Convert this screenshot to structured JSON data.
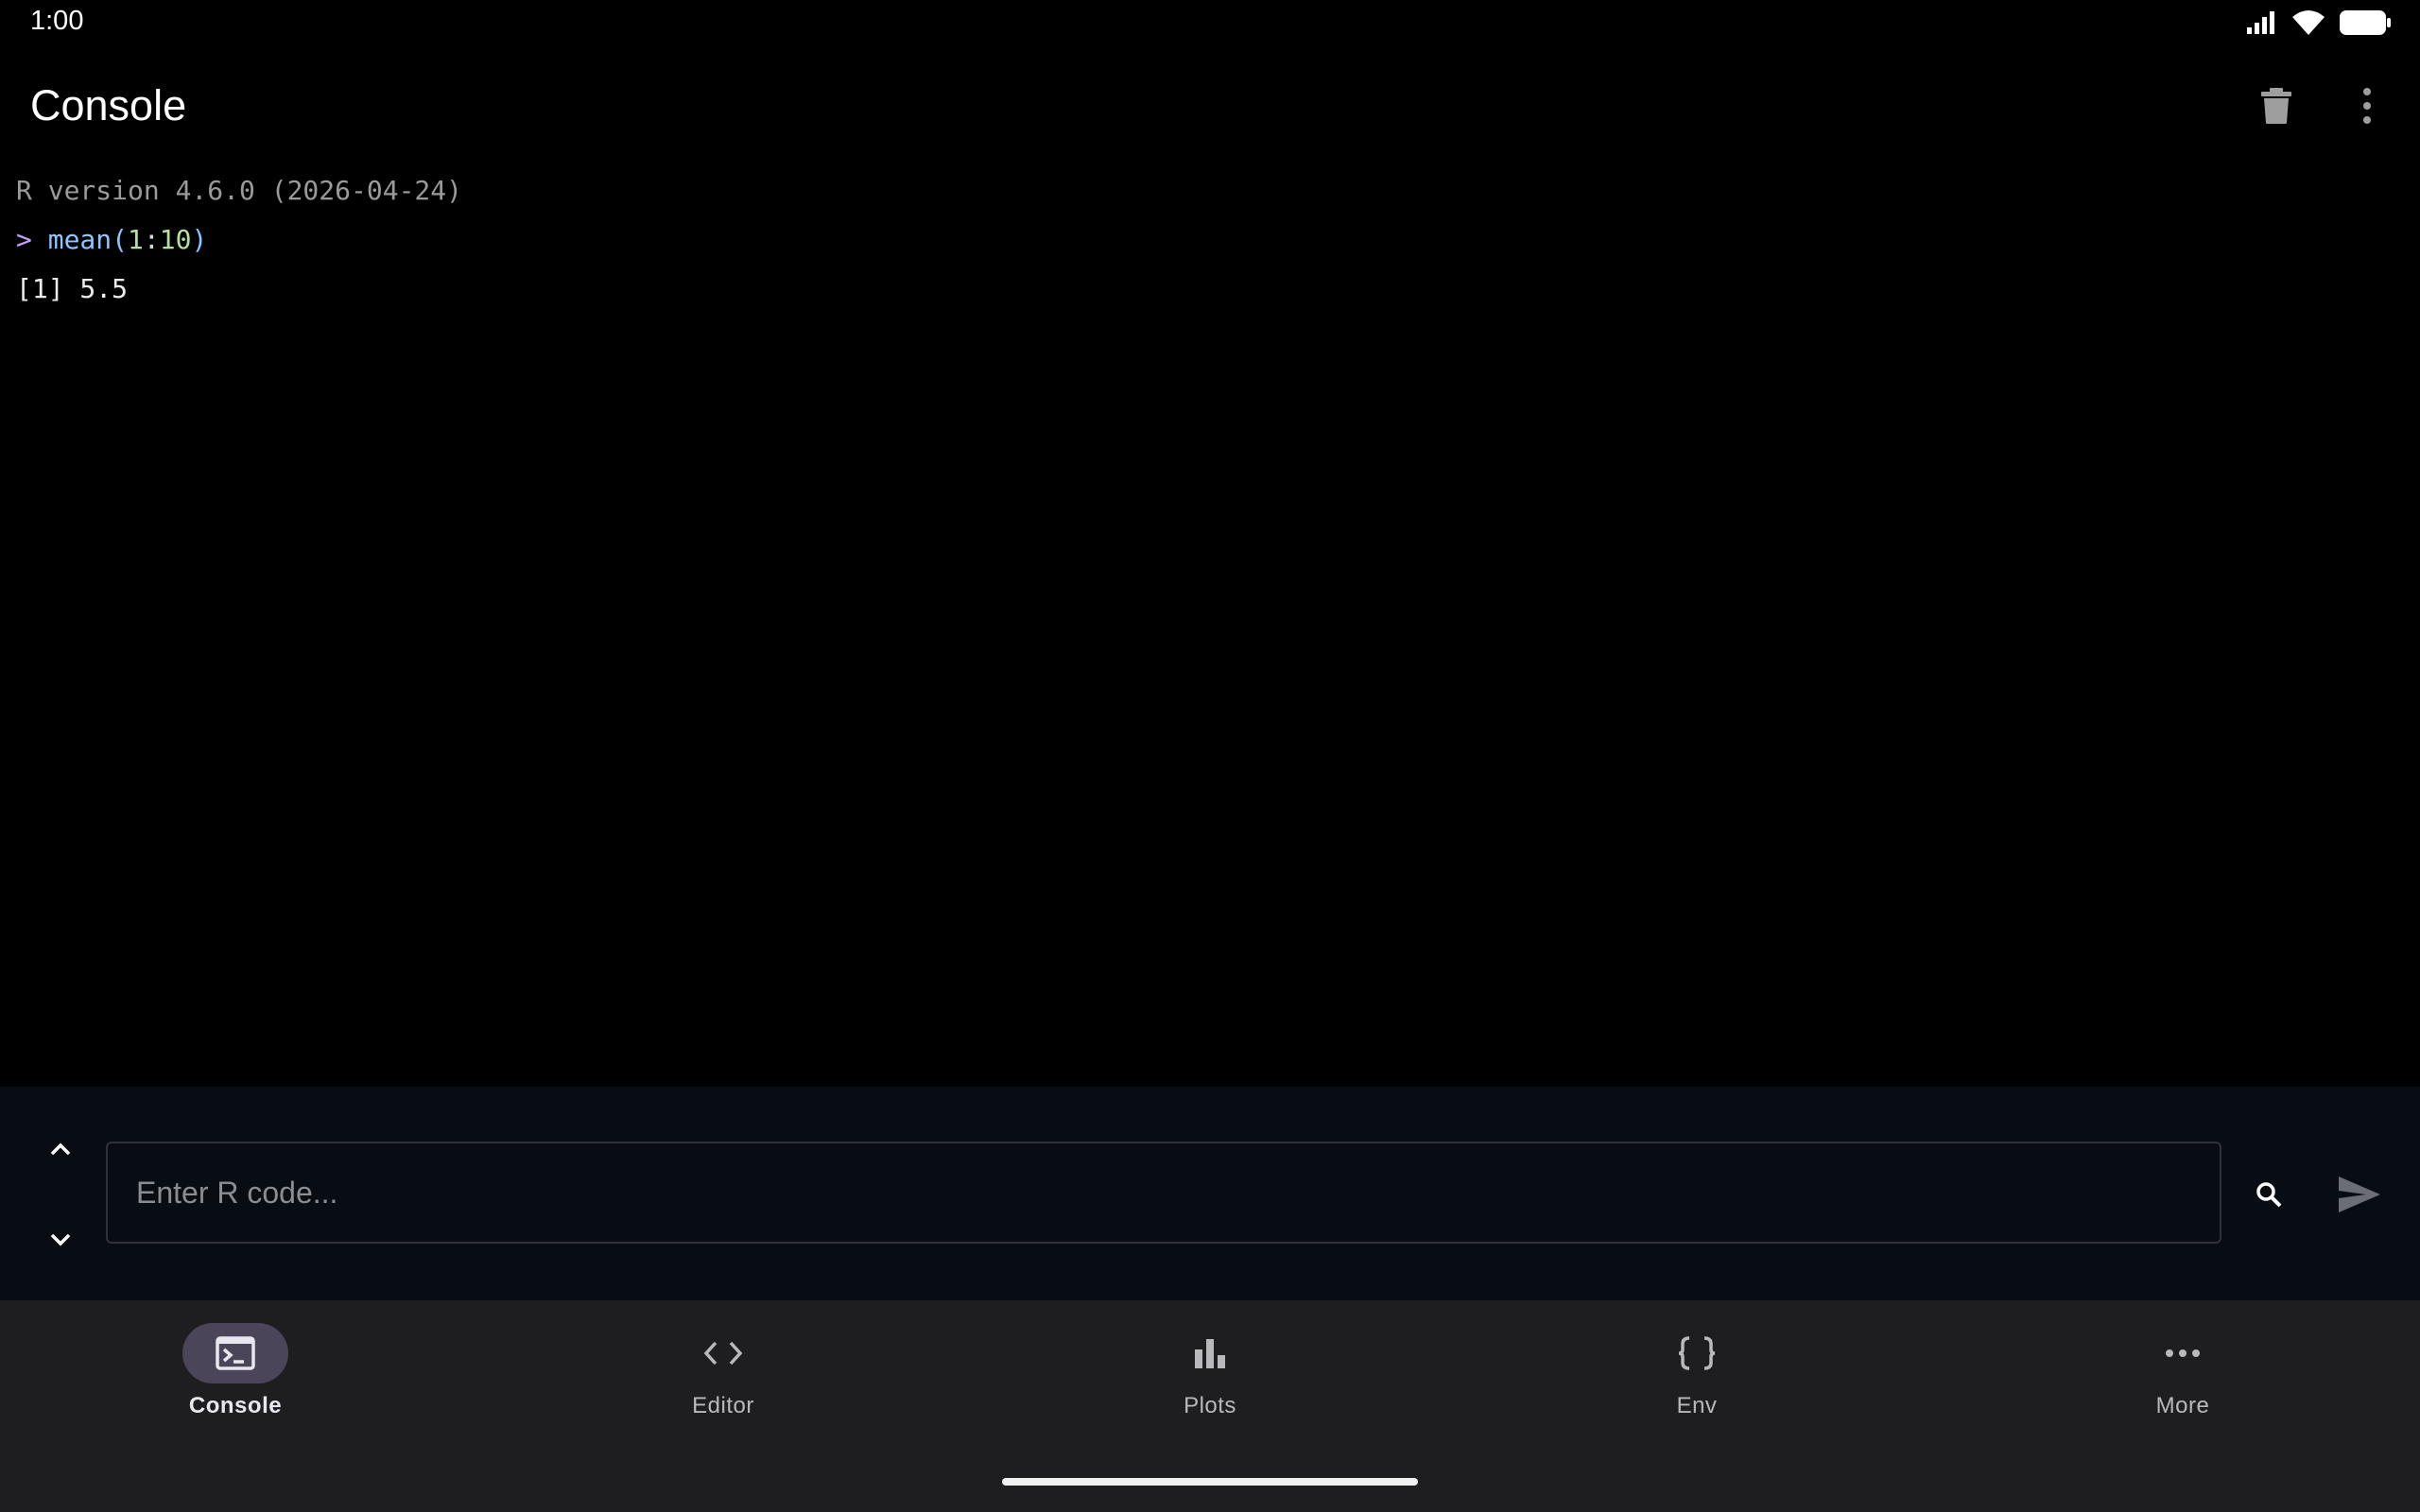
{
  "status_bar": {
    "time": "1:00",
    "icons": [
      "signal-icon",
      "wifi-icon",
      "battery-icon"
    ]
  },
  "app_bar": {
    "title": "Console",
    "actions": [
      "delete-icon",
      "more-vertical-icon"
    ]
  },
  "console": {
    "version_line": "R version 4.6.0 (2026-04-24)",
    "prompt": ">",
    "command": {
      "fn": "mean",
      "open_paren": "(",
      "arg_start": "1",
      "sep": ":",
      "arg_end": "10",
      "close_paren": ")"
    },
    "output": "[1] 5.5"
  },
  "input_bar": {
    "placeholder": "Enter R code...",
    "value": ""
  },
  "nav": {
    "items": [
      {
        "label": "Console",
        "icon": "terminal-icon",
        "active": true
      },
      {
        "label": "Editor",
        "icon": "code-icon",
        "active": false
      },
      {
        "label": "Plots",
        "icon": "bar-chart-icon",
        "active": false
      },
      {
        "label": "Env",
        "icon": "braces-icon",
        "active": false
      },
      {
        "label": "More",
        "icon": "more-horizontal-icon",
        "active": false
      }
    ]
  },
  "colors": {
    "background": "#000000",
    "input_bar": "#080d14",
    "nav_bar": "#1e1e20",
    "active_pill": "#4a4558",
    "prompt": "#c9a0ff",
    "function": "#8ec4ff",
    "number": "#b6e0a0"
  }
}
